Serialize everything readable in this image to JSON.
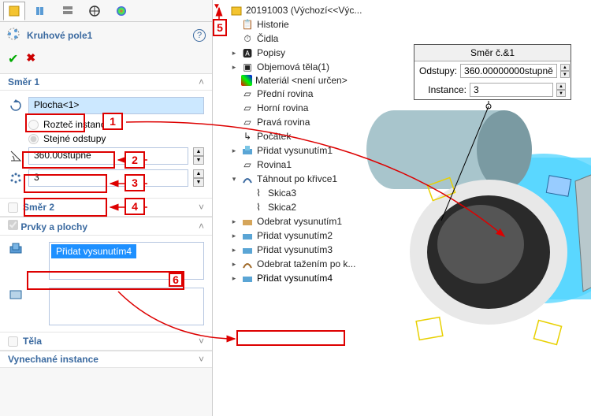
{
  "tabs": {
    "active": 0
  },
  "feature": {
    "title": "Kruhové pole1"
  },
  "section1": {
    "title": "Směr 1",
    "face_value": "Plocha<1>",
    "radio_spacing": "Rozteč instancí",
    "radio_equal": "Stejné odstupy",
    "angle_value": "360.00stupně",
    "count_value": "3"
  },
  "section2": {
    "title": "Směr 2"
  },
  "section3": {
    "title": "Prvky a plochy",
    "selected_feature": "Přidat vysunutím4"
  },
  "section4": {
    "title": "Těla"
  },
  "section5": {
    "title": "Vynechané instance"
  },
  "callouts": {
    "c1": "1",
    "c2": "2",
    "c3": "3",
    "c4": "4",
    "c5": "5",
    "c6": "6"
  },
  "tree": {
    "root": "20191003   (Výchozí<<Výc...",
    "history": "Historie",
    "sensors": "Čidla",
    "annotations": "Popisy",
    "bodies": "Objemová těla(1)",
    "material": "Materiál <není určen>",
    "front": "Přední rovina",
    "top": "Horní rovina",
    "right": "Pravá rovina",
    "origin": "Počátek",
    "ext1": "Přidat vysunutím1",
    "plane1": "Rovina1",
    "sweep": "Táhnout po křivce1",
    "sketch3": "Skica3",
    "sketch2": "Skica2",
    "cut1": "Odebrat vysunutím1",
    "ext2": "Přidat vysunutím2",
    "ext3": "Přidat vysunutím3",
    "cutSweep": "Odebrat tažením po k...",
    "ext4": "Přidat vysunutím4"
  },
  "popup": {
    "title": "Směr č.&1",
    "spacing_label": "Odstupy:",
    "spacing_value": "360.00000000stupně",
    "instances_label": "Instance:",
    "instances_value": "3"
  }
}
